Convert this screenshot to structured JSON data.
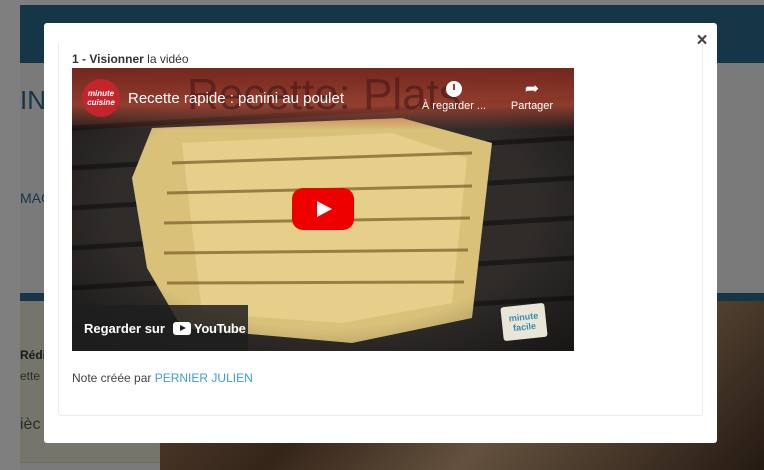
{
  "background": {
    "title_fragment": "IN",
    "link_fragment": "MAG",
    "card_line1": "Rédi",
    "card_line2": "ette",
    "card_line3": "ièc"
  },
  "modal": {
    "close_icon": "×",
    "step_number": "1 - ",
    "step_action": "Visionner",
    "step_rest": " la vidéo",
    "video": {
      "channel_logo_line1": "minute",
      "channel_logo_line2": "cuisine",
      "watermark": "Recette: Plats",
      "title": "Recette rapide : panini au poulet",
      "watch_later_label": "À regarder ...",
      "share_label": "Partager",
      "share_icon": "➦",
      "watch_on_label": "Regarder sur",
      "youtube_logo_text": "YouTube",
      "badge_line1": "minute",
      "badge_line2": "facile"
    },
    "note_prefix": "Note créée par ",
    "note_author": "PERNIER JULIEN"
  },
  "colors": {
    "header_blue": "#2b6c8e",
    "link": "#3aa0c6",
    "play_red": "#ee0000"
  }
}
